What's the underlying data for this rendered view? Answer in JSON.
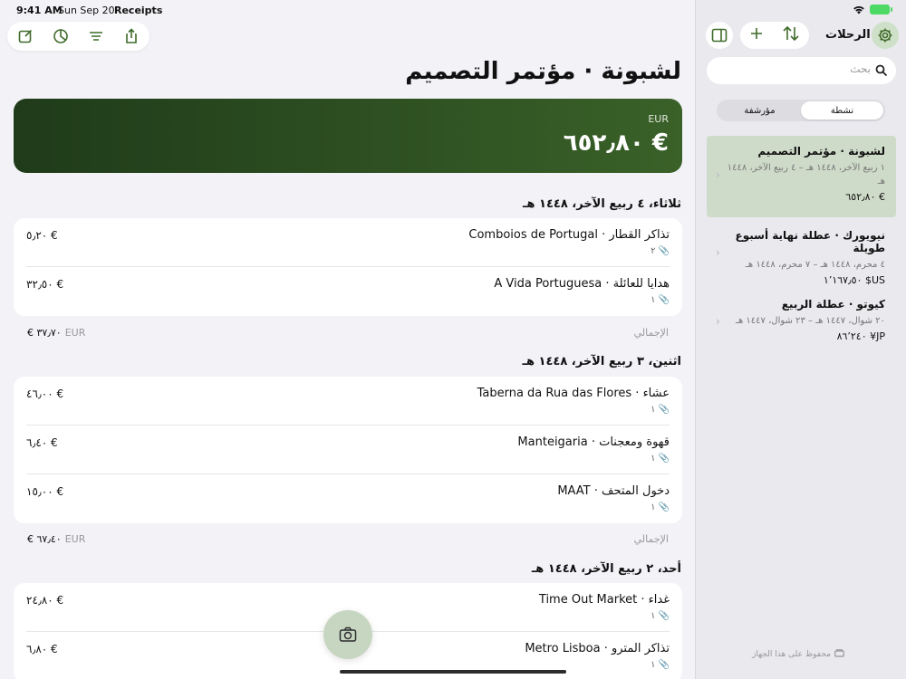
{
  "status": {
    "time": "9:41 AM",
    "date": "Sun Sep 20",
    "app": "Receipts"
  },
  "colors": {
    "accent": "#3f6b2a",
    "hero_start": "#1f3b1a",
    "hero_end": "#3a6128"
  },
  "toolbar": {
    "icons": [
      "compose-icon",
      "pie-chart-icon",
      "filter-icon",
      "share-icon"
    ]
  },
  "trip": {
    "title": "لشبونة · مؤتمر التصميم",
    "currency": "EUR",
    "total": "€ ٦٥٢٫٨٠"
  },
  "days": [
    {
      "header": "ثلاثاء، ٤ ربيع الآخر، ١٤٤٨ هـ",
      "items": [
        {
          "title": "تذاكر القطار · Comboios de Portugal",
          "attachments": "٢",
          "price": "€ ٥٫٢٠"
        },
        {
          "title": "هدايا للعائلة · A Vida Portuguesa",
          "attachments": "١",
          "price": "€ ٣٢٫٥٠"
        }
      ],
      "total_label": "الإجمالي",
      "total_value": "€ ٣٧٫٧٠",
      "total_currency": "EUR"
    },
    {
      "header": "اثنين، ٣ ربيع الآخر، ١٤٤٨ هـ",
      "items": [
        {
          "title": "عشاء · Taberna da Rua das Flores",
          "attachments": "١",
          "price": "€ ٤٦٫٠٠"
        },
        {
          "title": "قهوة ومعجنات · Manteigaria",
          "attachments": "١",
          "price": "€ ٦٫٤٠"
        },
        {
          "title": "دخول المتحف · MAAT",
          "attachments": "١",
          "price": "€ ١٥٫٠٠"
        }
      ],
      "total_label": "الإجمالي",
      "total_value": "€ ٦٧٫٤٠",
      "total_currency": "EUR"
    },
    {
      "header": "أحد، ٢ ربيع الآخر، ١٤٤٨ هـ",
      "items": [
        {
          "title": "غداء · Time Out Market",
          "attachments": "١",
          "price": "€ ٢٤٫٨٠"
        },
        {
          "title": "تذاكر المترو · Metro Lisboa",
          "attachments": "١",
          "price": "€ ٦٫٨٠"
        }
      ]
    }
  ],
  "sidebar": {
    "title": "الرحلات",
    "search_placeholder": "بحث",
    "segments": [
      "نشطة",
      "مؤرشفة"
    ],
    "trips": [
      {
        "name": "لشبونة · مؤتمر التصميم",
        "dates": "١ ربيع الآخر، ١٤٤٨ هـ – ٤ ربيع الآخر، ١٤٤٨ هـ",
        "total": "€ ٦٥٢٫٨٠"
      },
      {
        "name": "نيويورك · عطلة نهاية أسبوع طويلة",
        "dates": "٤ محرم، ١٤٤٨ هـ – ٧ محرم، ١٤٤٨ هـ",
        "total": "US$ ١٬١٦٧٫٥٠"
      },
      {
        "name": "كيوتو · عطلة الربيع",
        "dates": "٢٠ شوال، ١٤٤٧ هـ – ٢٣ شوال، ١٤٤٧ هـ",
        "total": "JP¥ ٨٦٬٢٤٠"
      }
    ],
    "footer": "محفوظ على هذا الجهاز"
  }
}
